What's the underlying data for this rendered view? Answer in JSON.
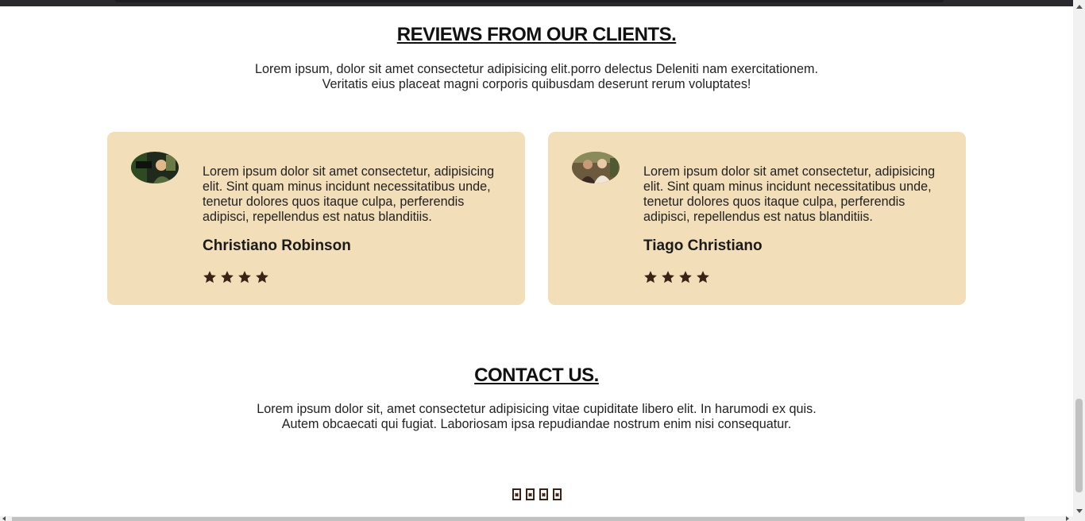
{
  "reviews": {
    "title": "REVIEWS FROM OUR CLIENTS.",
    "intro_line1": "Lorem ipsum, dolor sit amet consectetur adipisicing elit.porro delectus Deleniti nam exercitationem.",
    "intro_line2": "Veritatis eius placeat magni corporis quibusdam deserunt rerum voluptates!",
    "cards": [
      {
        "text": "Lorem ipsum dolor sit amet consectetur, adipisicing elit. Sint quam minus incidunt necessitatibus unde, tenetur dolores quos itaque culpa, perferendis adipisci, repellendus est natus blanditiis.",
        "name": "Christiano Robinson",
        "rating": 4
      },
      {
        "text": "Lorem ipsum dolor sit amet consectetur, adipisicing elit. Sint quam minus incidunt necessitatibus unde, tenetur dolores quos itaque culpa, perferendis adipisci, repellendus est natus blanditiis.",
        "name": "Tiago Christiano",
        "rating": 4
      }
    ]
  },
  "contact": {
    "title": "CONTACT US.",
    "line1": "Lorem ipsum dolor sit, amet consectetur adipisicing vitae cupiditate libero elit. In harumodi ex quis.",
    "line2": "Autem obcaecati qui fugiat. Laboriosam ipsa repudiandae nostrum enim nisi consequatur."
  },
  "social_icons": [
    "missing-glyph-icon",
    "missing-glyph-icon",
    "missing-glyph-icon",
    "missing-glyph-icon"
  ],
  "colors": {
    "card_bg": "#f2deb8",
    "star": "#3a2316",
    "heading": "#111111"
  }
}
